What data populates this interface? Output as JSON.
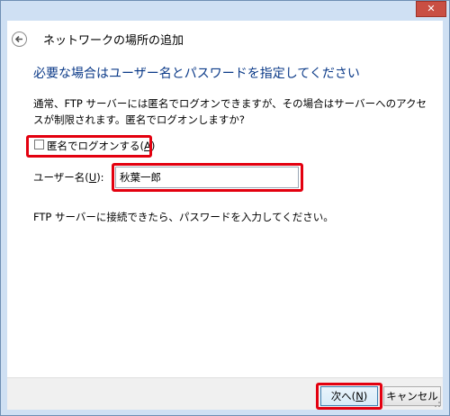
{
  "window": {
    "close_glyph": "✕"
  },
  "header": {
    "title": "ネットワークの場所の追加",
    "back_icon": "back-arrow-icon"
  },
  "main": {
    "heading": "必要な場合はユーザー名とパスワードを指定してください",
    "description": "通常、FTP サーバーには匿名でログオンできますが、その場合はサーバーへのアクセスが制限されます。匿名でログオンしますか?",
    "anonymous_checkbox": {
      "label_prefix": "匿名でログオンする(",
      "label_accel": "A",
      "label_suffix": ")",
      "checked": false
    },
    "username": {
      "label_prefix": "ユーザー名(",
      "label_accel": "U",
      "label_suffix": "):",
      "value": "秋葉一郎"
    },
    "info": "FTP サーバーに接続できたら、パスワードを入力してください。"
  },
  "footer": {
    "next_prefix": "次へ(",
    "next_accel": "N",
    "next_suffix": ")",
    "cancel": "キャンセル"
  },
  "colors": {
    "highlight": "#e3000f",
    "heading": "#0b3a88",
    "frame": "#cfe0f3"
  }
}
